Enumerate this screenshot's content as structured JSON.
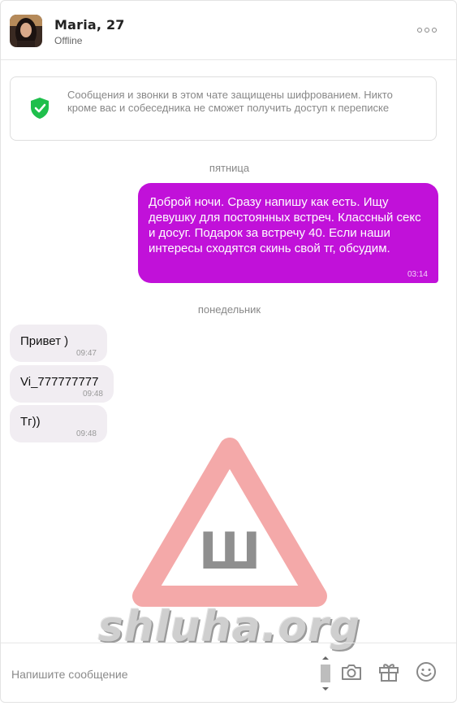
{
  "header": {
    "name": "Maria, 27",
    "status": "Offline"
  },
  "notice": {
    "text": "Сообщения и звонки в этом чате защищены шифрованием. Никто кроме вас и собеседника не сможет получить доступ к переписке"
  },
  "days": [
    "пятница",
    "понедельник"
  ],
  "messages": {
    "outgoing": {
      "text": "Доброй ночи. Сразу напишу как есть. Ищу девушку для постоянных встреч. Классный секс и досуг. Подарок за встречу 40. Если наши интересы сходятся скинь свой тг, обсудим.",
      "time": "03:14"
    },
    "incoming": [
      {
        "text": "Привет )",
        "time": "09:47"
      },
      {
        "text": "Vi_777777777",
        "time": "09:48"
      },
      {
        "text": "Тг))",
        "time": "09:48"
      }
    ]
  },
  "watermark": {
    "text": "shluha.org",
    "glyph": "Ш"
  },
  "composer": {
    "placeholder": "Напишите сообщение"
  },
  "colors": {
    "accent": "#c111d9",
    "incoming_bubble": "#f1edf2",
    "shield": "#1fbf4c",
    "warning": "#f5a0a0"
  },
  "icons": [
    "more-icon",
    "shield-check-icon",
    "camera-icon",
    "gift-icon",
    "emoji-icon"
  ]
}
